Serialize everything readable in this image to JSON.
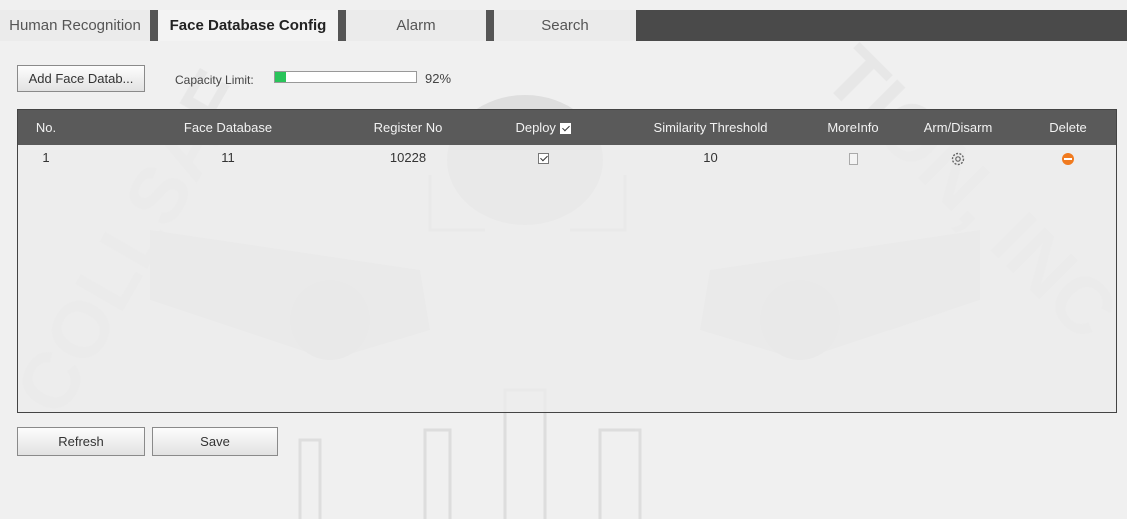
{
  "tabs": [
    {
      "label": "Human Recognition",
      "active": false
    },
    {
      "label": "Face Database Config",
      "active": true
    },
    {
      "label": "Alarm",
      "active": false
    },
    {
      "label": "Search",
      "active": false
    }
  ],
  "toolbar": {
    "add_button_label": "Add Face Datab...",
    "capacity_label": "Capacity Limit:",
    "capacity_percent_text": "92%",
    "capacity_fraction": 0.08
  },
  "table": {
    "columns": [
      "No.",
      "Face Database",
      "Register No",
      "Deploy",
      "Similarity Threshold",
      "MoreInfo",
      "Arm/Disarm",
      "Delete"
    ],
    "rows": [
      {
        "no": "1",
        "face_database": "11",
        "register_no": "10228",
        "deploy_checked": true,
        "similarity_threshold": "10"
      }
    ]
  },
  "footer": {
    "refresh_label": "Refresh",
    "save_label": "Save"
  },
  "icons": {
    "more_info": "document-icon",
    "arm_disarm": "gear-icon",
    "delete": "delete-icon"
  },
  "colors": {
    "tab_bar_dark": "#4a4a4a",
    "table_header": "#5a5a5a",
    "capacity_fill": "#29c45a",
    "delete_icon": "#f07a1f"
  }
}
